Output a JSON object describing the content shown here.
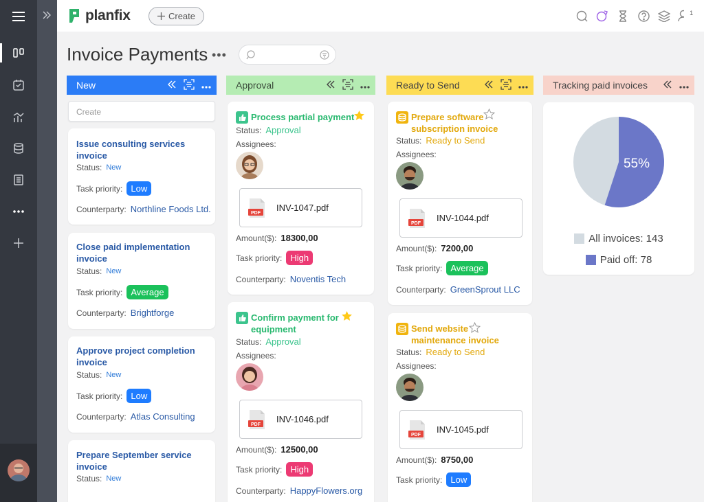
{
  "app": {
    "logo_text": "planfix",
    "create_label": "Create"
  },
  "page": {
    "title": "Invoice Payments",
    "search_placeholder": ""
  },
  "colors": {
    "new": "#2b7cf6",
    "approval": "#b5ecb3",
    "ready": "#fddc54",
    "tracking": "#f8d3ca"
  },
  "columns": [
    {
      "name": "New",
      "create_placeholder": "Create"
    },
    {
      "name": "Approval"
    },
    {
      "name": "Ready to Send"
    },
    {
      "name": "Tracking paid invoices"
    }
  ],
  "labels": {
    "status": "Status:",
    "assignees": "Assignees:",
    "task_priority": "Task priority:",
    "counterparty": "Counterparty:",
    "amount": "Amount($):"
  },
  "new_cards": [
    {
      "title": "Issue consulting services invoice",
      "status": "New",
      "priority": "Low",
      "counterparty": "Northline Foods Ltd."
    },
    {
      "title": "Close paid implementation invoice",
      "status": "New",
      "priority": "Average",
      "counterparty": "Brightforge"
    },
    {
      "title": "Approve project completion invoice",
      "status": "New",
      "priority": "Low",
      "counterparty": "Atlas Consulting"
    },
    {
      "title": "Prepare September service invoice",
      "status": "New"
    }
  ],
  "approval_cards": [
    {
      "title": "Process partial payment",
      "status": "Approval",
      "file": "INV-1047.pdf",
      "amount": "18300,00",
      "priority": "High",
      "counterparty": "Noventis Tech"
    },
    {
      "title": "Confirm payment for equipment",
      "status": "Approval",
      "file": "INV-1046.pdf",
      "amount": "12500,00",
      "priority": "High",
      "counterparty": "HappyFlowers.org"
    }
  ],
  "ready_cards": [
    {
      "title": "Prepare software subscription invoice",
      "status": "Ready to Send",
      "file": "INV-1044.pdf",
      "amount": "7200,00",
      "priority": "Average",
      "counterparty": "GreenSprout LLC"
    },
    {
      "title": "Send website maintenance invoice",
      "status": "Ready to Send",
      "file": "INV-1045.pdf",
      "amount": "8750,00",
      "priority": "Low"
    }
  ],
  "tracking": {
    "percent_label": "55%",
    "paid_fraction": 0.55,
    "all_label": "All invoices: 143",
    "paid_label": "Paid off: 78",
    "colors": {
      "all": "#d3dbe1",
      "paid": "#6b77c8"
    }
  },
  "file_icon_text": "PDF",
  "top_icons": [
    "search-icon",
    "magic-icon",
    "hourglass-icon",
    "help-icon",
    "layers-icon",
    "user-icon"
  ],
  "user_badge": "1"
}
